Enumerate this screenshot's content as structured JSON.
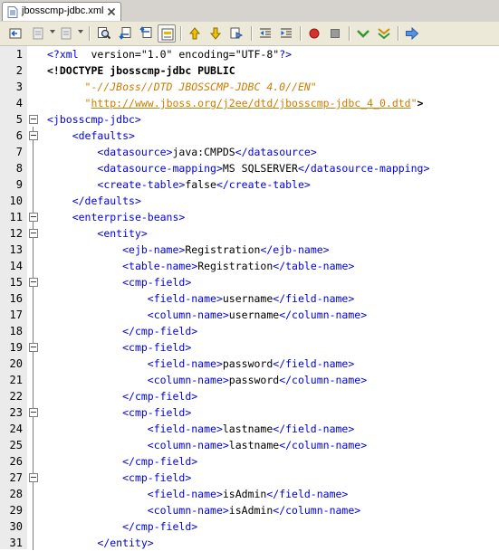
{
  "tab": {
    "title": "jbosscmp-jdbc.xml"
  },
  "toolbar": {
    "icons": [
      "back-to-last-edit-icon",
      "go-back-icon",
      "go-forward-icon",
      "find-icon",
      "find-previous-icon",
      "find-next-icon",
      "toggle-highlight-icon",
      "previous-bookmark-icon",
      "next-bookmark-icon",
      "toggle-bookmark-icon",
      "shift-left-icon",
      "shift-right-icon",
      "record-macro-icon",
      "stop-macro-icon",
      "check-xml-icon",
      "validate-xml-icon",
      "xsl-transform-icon"
    ]
  },
  "editor": {
    "lines": [
      {
        "n": "1",
        "parts": [
          [
            "pi",
            "<?xml"
          ],
          [
            "",
            "  version=\"1.0\" encoding=\"UTF-8\""
          ],
          [
            "pi",
            "?>"
          ]
        ]
      },
      {
        "n": "2",
        "parts": [
          [
            "kw",
            "<!DOCTYPE jbosscmp-jdbc PUBLIC"
          ]
        ]
      },
      {
        "n": "3",
        "parts": [
          [
            "",
            "      "
          ],
          [
            "str",
            "\"-//JBoss//DTD JBOSSCMP-JDBC 4.0//EN\""
          ]
        ]
      },
      {
        "n": "4",
        "parts": [
          [
            "",
            "      "
          ],
          [
            "str",
            "\""
          ],
          [
            "url",
            "http://www.jboss.org/j2ee/dtd/jbosscmp-jdbc_4_0.dtd"
          ],
          [
            "str",
            "\""
          ],
          [
            "kw",
            ">"
          ]
        ]
      },
      {
        "n": "5",
        "parts": [
          [
            "tag",
            "<jbosscmp-jdbc>"
          ]
        ]
      },
      {
        "n": "6",
        "parts": [
          [
            "",
            "    "
          ],
          [
            "tag",
            "<defaults>"
          ]
        ]
      },
      {
        "n": "7",
        "parts": [
          [
            "",
            "        "
          ],
          [
            "tag",
            "<datasource>"
          ],
          [
            "",
            "java:CMPDS"
          ],
          [
            "tag",
            "</datasource>"
          ]
        ]
      },
      {
        "n": "8",
        "parts": [
          [
            "",
            "        "
          ],
          [
            "tag",
            "<datasource-mapping>"
          ],
          [
            "",
            "MS SQLSERVER"
          ],
          [
            "tag",
            "</datasource-mapping>"
          ]
        ]
      },
      {
        "n": "9",
        "parts": [
          [
            "",
            "        "
          ],
          [
            "tag",
            "<create-table>"
          ],
          [
            "",
            "false"
          ],
          [
            "tag",
            "</create-table>"
          ]
        ]
      },
      {
        "n": "10",
        "parts": [
          [
            "",
            "    "
          ],
          [
            "tag",
            "</defaults>"
          ]
        ]
      },
      {
        "n": "11",
        "parts": [
          [
            "",
            "    "
          ],
          [
            "tag",
            "<enterprise-beans>"
          ]
        ]
      },
      {
        "n": "12",
        "parts": [
          [
            "",
            "        "
          ],
          [
            "tag",
            "<entity>"
          ]
        ]
      },
      {
        "n": "13",
        "parts": [
          [
            "",
            "            "
          ],
          [
            "tag",
            "<ejb-name>"
          ],
          [
            "",
            "Registration"
          ],
          [
            "tag",
            "</ejb-name>"
          ]
        ]
      },
      {
        "n": "14",
        "parts": [
          [
            "",
            "            "
          ],
          [
            "tag",
            "<table-name>"
          ],
          [
            "",
            "Registration"
          ],
          [
            "tag",
            "</table-name>"
          ]
        ]
      },
      {
        "n": "15",
        "parts": [
          [
            "",
            "            "
          ],
          [
            "tag",
            "<cmp-field>"
          ]
        ]
      },
      {
        "n": "16",
        "parts": [
          [
            "",
            "                "
          ],
          [
            "tag",
            "<field-name>"
          ],
          [
            "",
            "username"
          ],
          [
            "tag",
            "</field-name>"
          ]
        ]
      },
      {
        "n": "17",
        "parts": [
          [
            "",
            "                "
          ],
          [
            "tag",
            "<column-name>"
          ],
          [
            "",
            "username"
          ],
          [
            "tag",
            "</column-name>"
          ]
        ]
      },
      {
        "n": "18",
        "parts": [
          [
            "",
            "            "
          ],
          [
            "tag",
            "</cmp-field>"
          ]
        ]
      },
      {
        "n": "19",
        "parts": [
          [
            "",
            "            "
          ],
          [
            "tag",
            "<cmp-field>"
          ]
        ]
      },
      {
        "n": "20",
        "parts": [
          [
            "",
            "                "
          ],
          [
            "tag",
            "<field-name>"
          ],
          [
            "",
            "password"
          ],
          [
            "tag",
            "</field-name>"
          ]
        ]
      },
      {
        "n": "21",
        "parts": [
          [
            "",
            "                "
          ],
          [
            "tag",
            "<column-name>"
          ],
          [
            "",
            "password"
          ],
          [
            "tag",
            "</column-name>"
          ]
        ]
      },
      {
        "n": "22",
        "parts": [
          [
            "",
            "            "
          ],
          [
            "tag",
            "</cmp-field>"
          ]
        ]
      },
      {
        "n": "23",
        "parts": [
          [
            "",
            "            "
          ],
          [
            "tag",
            "<cmp-field>"
          ]
        ]
      },
      {
        "n": "24",
        "parts": [
          [
            "",
            "                "
          ],
          [
            "tag",
            "<field-name>"
          ],
          [
            "",
            "lastname"
          ],
          [
            "tag",
            "</field-name>"
          ]
        ]
      },
      {
        "n": "25",
        "parts": [
          [
            "",
            "                "
          ],
          [
            "tag",
            "<column-name>"
          ],
          [
            "",
            "lastname"
          ],
          [
            "tag",
            "</column-name>"
          ]
        ]
      },
      {
        "n": "26",
        "parts": [
          [
            "",
            "            "
          ],
          [
            "tag",
            "</cmp-field>"
          ]
        ]
      },
      {
        "n": "27",
        "parts": [
          [
            "",
            "            "
          ],
          [
            "tag",
            "<cmp-field>"
          ]
        ]
      },
      {
        "n": "28",
        "parts": [
          [
            "",
            "                "
          ],
          [
            "tag",
            "<field-name>"
          ],
          [
            "",
            "isAdmin"
          ],
          [
            "tag",
            "</field-name>"
          ]
        ]
      },
      {
        "n": "29",
        "parts": [
          [
            "",
            "                "
          ],
          [
            "tag",
            "<column-name>"
          ],
          [
            "",
            "isAdmin"
          ],
          [
            "tag",
            "</column-name>"
          ]
        ]
      },
      {
        "n": "30",
        "parts": [
          [
            "",
            "            "
          ],
          [
            "tag",
            "</cmp-field>"
          ]
        ]
      },
      {
        "n": "31",
        "parts": [
          [
            "",
            "        "
          ],
          [
            "tag",
            "</entity>"
          ]
        ]
      }
    ]
  }
}
